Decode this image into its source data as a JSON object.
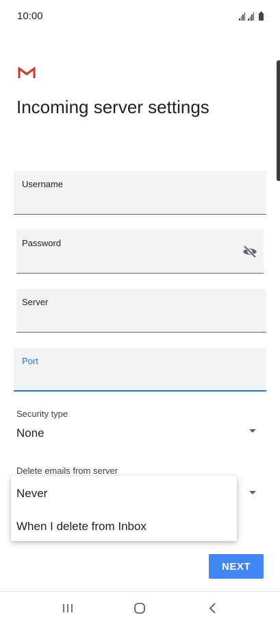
{
  "status_bar": {
    "time": "10:00"
  },
  "app": {
    "logo_icon": "gmail-logo-icon",
    "accent_color": "#1a73e8",
    "button_color": "#4285f4"
  },
  "page": {
    "title": "Incoming server settings"
  },
  "fields": {
    "username": {
      "label": "Username",
      "value": ""
    },
    "password": {
      "label": "Password",
      "value": "",
      "toggle_icon": "visibility-off-icon"
    },
    "server": {
      "label": "Server",
      "value": ""
    },
    "port": {
      "label": "Port",
      "value": "",
      "focused": true
    }
  },
  "security_type": {
    "label": "Security type",
    "value": "None"
  },
  "delete_emails": {
    "label": "Delete emails from server",
    "options": [
      "Never",
      "When I delete from Inbox"
    ]
  },
  "actions": {
    "next_label": "NEXT"
  },
  "nav_bar": {
    "recents_icon": "recents-icon",
    "home_icon": "home-icon",
    "back_icon": "back-icon"
  }
}
